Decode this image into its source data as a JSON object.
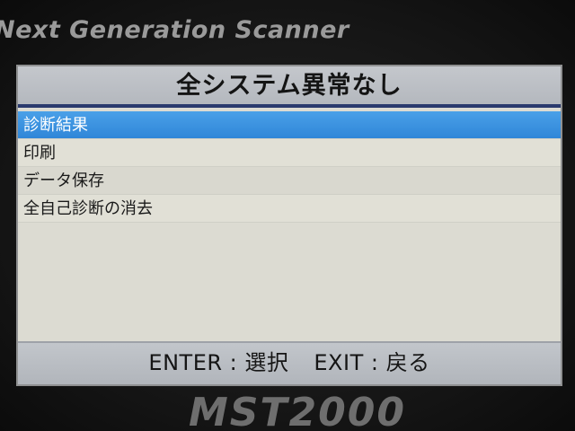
{
  "device": {
    "brand_top": "Next Generation Scanner",
    "brand_bottom": "MST2000"
  },
  "screen": {
    "title": "全システム異常なし",
    "menu_items": [
      {
        "label": "診断結果",
        "selected": true
      },
      {
        "label": "印刷",
        "selected": false
      },
      {
        "label": "データ保存",
        "selected": false
      },
      {
        "label": "全自己診断の消去",
        "selected": false
      }
    ],
    "footer": {
      "enter_hint": "ENTER : 選択",
      "exit_hint": "EXIT : 戻る"
    }
  },
  "colors": {
    "selection": "#2f86d8",
    "title_underline": "#2a3a6e",
    "screen_background": "#dcdbd2"
  }
}
